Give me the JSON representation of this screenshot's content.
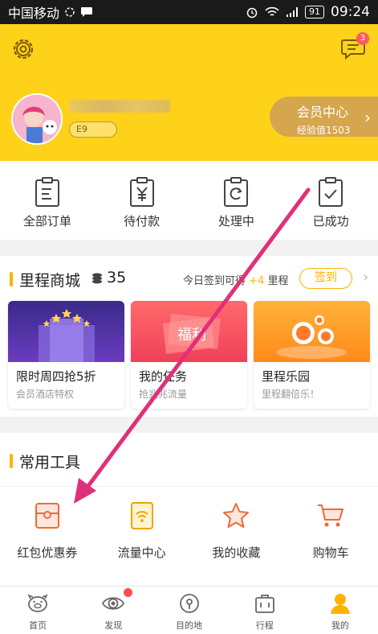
{
  "status_bar": {
    "carrier": "中国移动",
    "battery": "91",
    "time": "09:24"
  },
  "header": {
    "message_badge": "3",
    "level_text": "E9",
    "vip_title": "会员中心",
    "vip_subtitle": "经验值1503"
  },
  "orders": [
    {
      "label": "全部订单",
      "icon": "list-icon"
    },
    {
      "label": "待付款",
      "icon": "yuan-icon"
    },
    {
      "label": "处理中",
      "icon": "refresh-icon"
    },
    {
      "label": "已成功",
      "icon": "check-icon"
    }
  ],
  "mall": {
    "title": "里程商城",
    "points": "35",
    "checkin_text": "今日签到可得",
    "checkin_bonus": "+4",
    "checkin_unit": "里程",
    "checkin_button": "签到",
    "cards": [
      {
        "title": "限时周四抢5折",
        "subtitle": "会员酒店特权"
      },
      {
        "title": "我的任务",
        "subtitle": "抢兆兆流量",
        "banner": "福利"
      },
      {
        "title": "里程乐园",
        "subtitle": "里程翻倍乐！"
      }
    ]
  },
  "tools": {
    "title": "常用工具",
    "items": [
      {
        "label": "红包优惠券",
        "icon": "coupon-icon"
      },
      {
        "label": "流量中心",
        "icon": "data-traffic-icon"
      },
      {
        "label": "我的收藏",
        "icon": "star-icon"
      },
      {
        "label": "购物车",
        "icon": "cart-icon"
      }
    ]
  },
  "bottom_nav": [
    {
      "label": "首页",
      "icon": "home-pig-icon"
    },
    {
      "label": "发现",
      "icon": "discover-eye-icon"
    },
    {
      "label": "目的地",
      "icon": "location-pin-icon"
    },
    {
      "label": "行程",
      "icon": "suitcase-icon"
    },
    {
      "label": "我的",
      "icon": "profile-icon"
    }
  ],
  "colors": {
    "header_yellow": "#ffd21a",
    "accent_orange": "#ffb300",
    "vip_gold": "#d6a64e",
    "annotation_magenta": "#e0307a"
  }
}
